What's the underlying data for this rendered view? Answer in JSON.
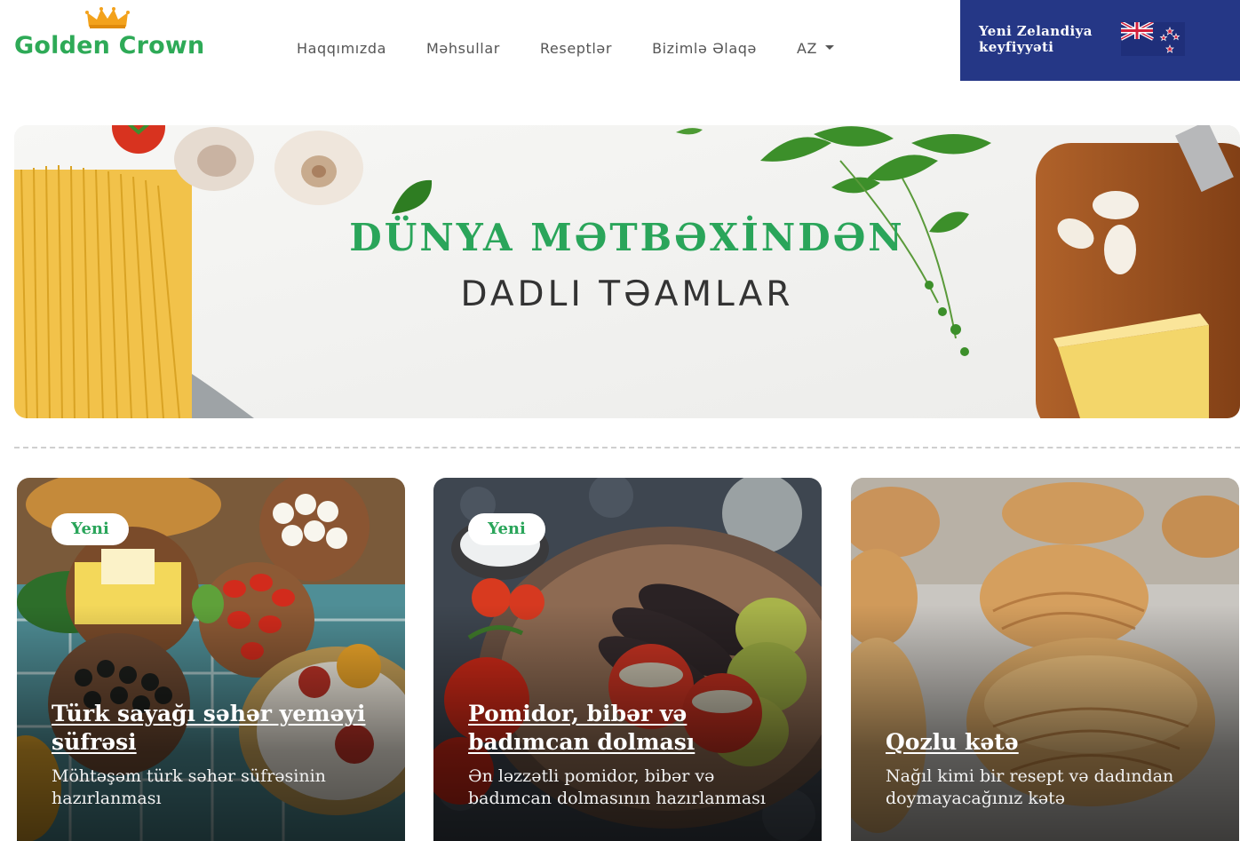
{
  "header": {
    "logo_text": "Golden Crown",
    "nav": {
      "about": "Haqqımızda",
      "products": "Məhsullar",
      "recipes": "Reseptlər",
      "contact": "Bizimlə Əlaqə",
      "language": "AZ"
    },
    "nz_quality": "Yeni Zelandiya keyfiyyəti"
  },
  "hero": {
    "title": "DÜNYA MƏTBƏXİNDƏN",
    "subtitle": "DADLI TƏAMLAR"
  },
  "cards": [
    {
      "badge": "Yeni",
      "title": "Türk sayağı səhər yeməyi süfrəsi",
      "description": "Möhtəşəm türk səhər süfrəsinin hazırlanması"
    },
    {
      "badge": "Yeni",
      "title": "Pomidor, bibər və badımcan dolması",
      "description": "Ən ləzzətli pomidor, bibər və badımcan dolmasının hazırlanması"
    },
    {
      "title": "Qozlu kətə",
      "description": "Nağıl kimi bir resept və dadından doymayacağınız kətə"
    }
  ],
  "colors": {
    "brand_green": "#2eaa57",
    "nz_blue": "#253786",
    "crown_gold": "#f3a21c"
  }
}
